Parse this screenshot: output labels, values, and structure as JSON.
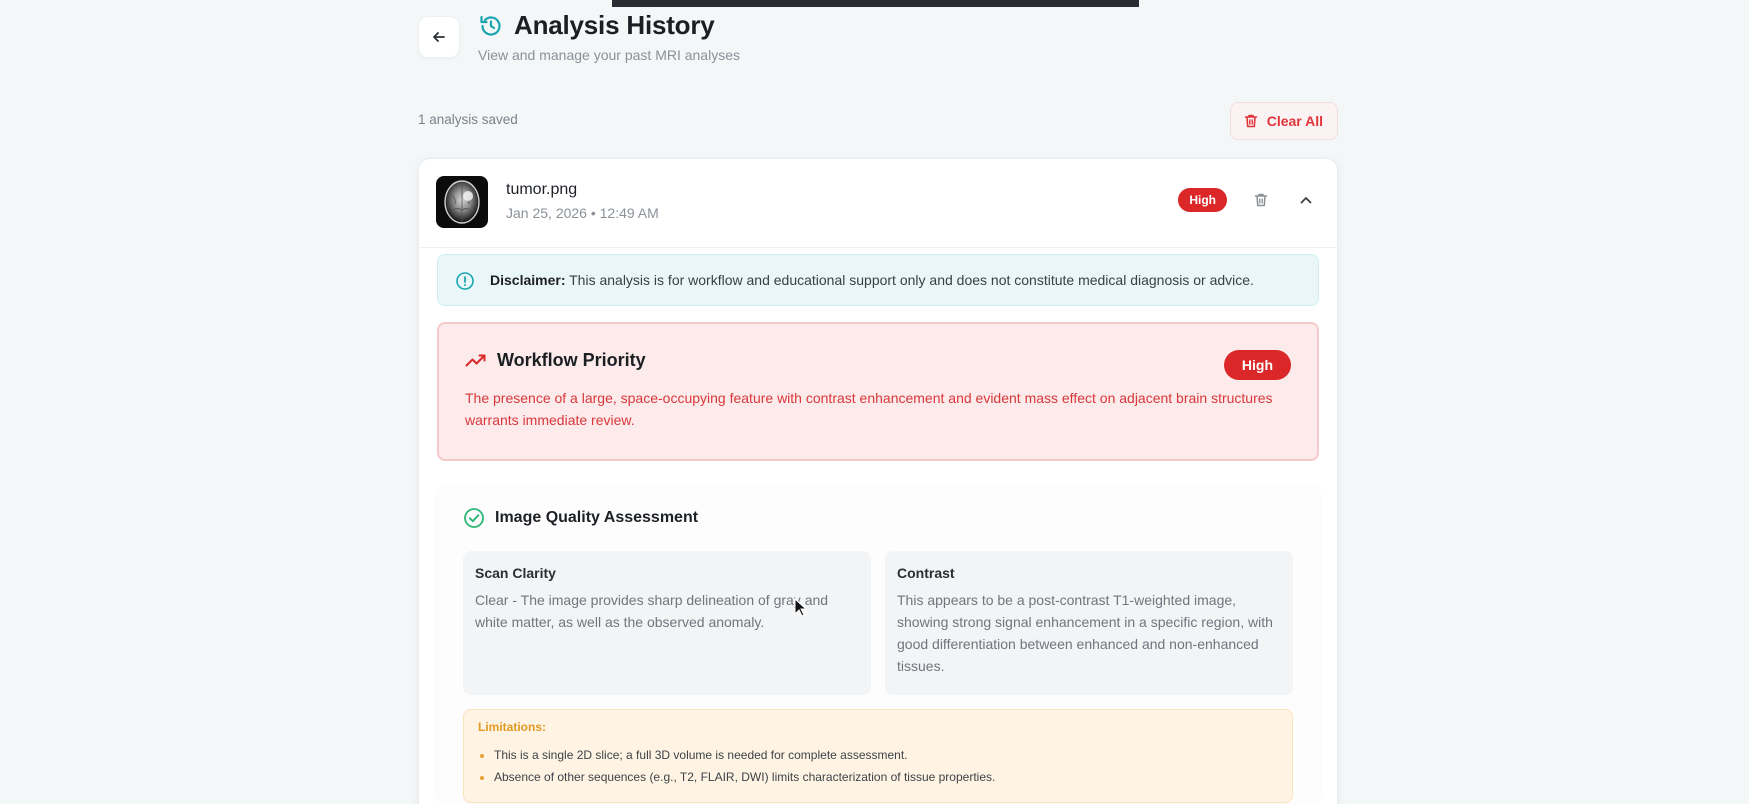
{
  "header": {
    "title": "Analysis History",
    "subtitle": "View and manage your past MRI analyses",
    "back_icon": "arrow-left-icon",
    "title_icon": "history-icon"
  },
  "toolbar": {
    "saved_count": "1 analysis saved",
    "clear_all_label": "Clear All",
    "clear_all_icon": "trash-icon"
  },
  "analysis": {
    "file_name": "tumor.png",
    "date": "Jan 25, 2026 • 12:49 AM",
    "priority_badge": "High",
    "disclaimer": {
      "label": "Disclaimer:",
      "text": " This analysis is for workflow and educational support only and does not constitute medical diagnosis or advice."
    },
    "workflow_priority": {
      "title": "Workflow Priority",
      "badge": "High",
      "text": "The presence of a large, space-occupying feature with contrast enhancement and evident mass effect on adjacent brain structures warrants immediate review."
    },
    "image_quality": {
      "title": "Image Quality Assessment",
      "scan_clarity": {
        "title": "Scan Clarity",
        "text": "Clear - The image provides sharp delineation of gray and white matter, as well as the observed anomaly."
      },
      "contrast": {
        "title": "Contrast",
        "text": "This appears to be a post-contrast T1-weighted image, showing strong signal enhancement in a specific region, with good differentiation between enhanced and non-enhanced tissues."
      },
      "limitations": {
        "title": "Limitations:",
        "items": [
          "This is a single 2D slice; a full 3D volume is needed for complete assessment.",
          "Absence of other sequences (e.g., T2, FLAIR, DWI) limits characterization of tissue properties."
        ]
      }
    }
  },
  "colors": {
    "accent_teal": "#1aa5b0",
    "danger": "#db2727",
    "priority_bg": "#fdeaea",
    "disclaimer_bg": "#eaf7f8",
    "limitations_bg": "#fff4e3",
    "success": "#2bb673"
  }
}
